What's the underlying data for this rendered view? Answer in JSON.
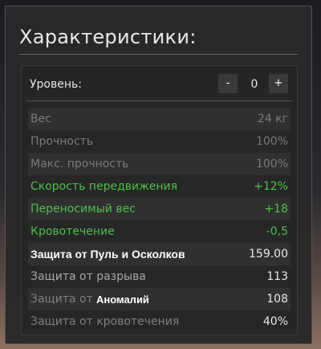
{
  "panel": {
    "title": "Характеристики:"
  },
  "level": {
    "label": "Уровень:",
    "minus": "-",
    "plus": "+",
    "value": "0"
  },
  "stats": [
    {
      "label": "Вес",
      "value": "24 кг",
      "tone": "dim"
    },
    {
      "label": "Прочность",
      "value": "100%",
      "tone": "dim"
    },
    {
      "label": "Макс. прочность",
      "value": "100%",
      "tone": "dim"
    },
    {
      "label": "Скорость передвижения",
      "value": "+12%",
      "tone": "green"
    },
    {
      "label": "Переносимый вес",
      "value": "+18",
      "tone": "green"
    },
    {
      "label": "Кровотечение",
      "value": "-0,5",
      "tone": "green"
    },
    {
      "label": "Защита от Пуль и Осколков",
      "value": "159.00",
      "tone": "bold"
    },
    {
      "label": "Защита от разрыва",
      "value": "113",
      "tone": "white"
    },
    {
      "label": "Защита от",
      "overlay": "Аномалий",
      "value": "108",
      "tone": "white2"
    },
    {
      "label": "Защита от кровотечения",
      "value": "40%",
      "tone": "white2"
    }
  ],
  "colors": {
    "green": "#4fbf4f",
    "dim_text": "#7b7b7b",
    "panel_bg": "#282828"
  }
}
